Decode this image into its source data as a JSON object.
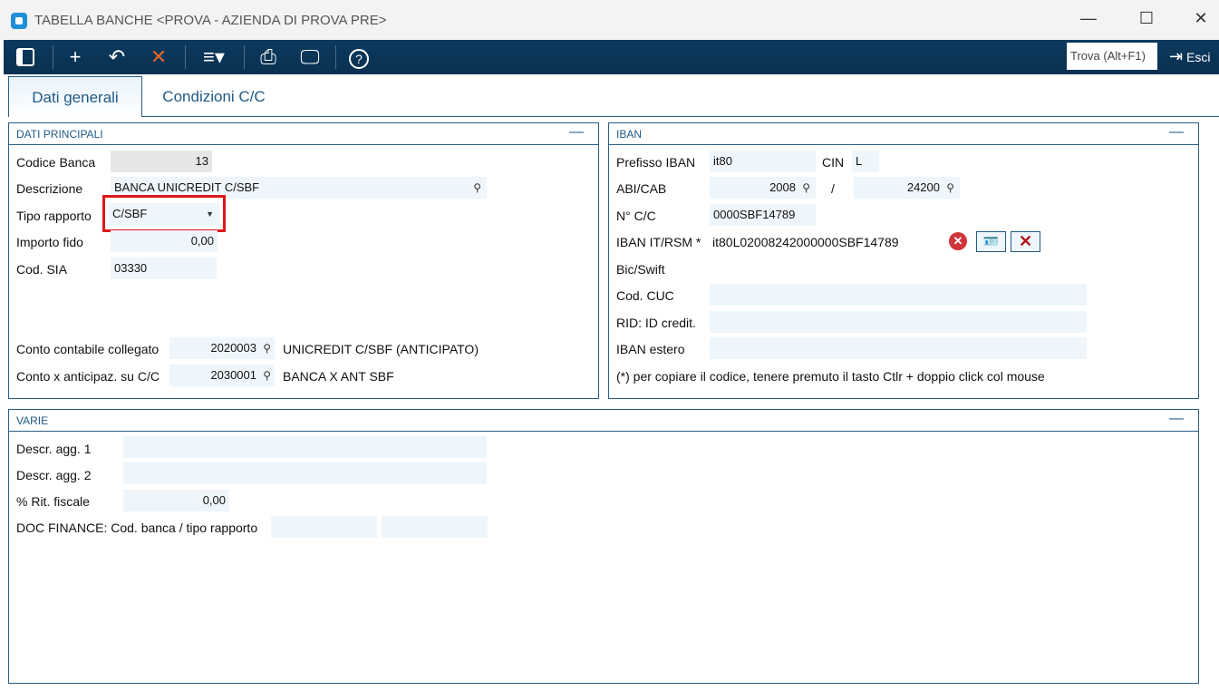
{
  "window": {
    "title": "TABELLA BANCHE <PROVA - AZIENDA DI PROVA PRE>",
    "minimize": "—",
    "maximize": "☐",
    "close": "✕"
  },
  "toolbar": {
    "find": "Trova (Alt+F1)",
    "exit": "Esci"
  },
  "tabs": [
    {
      "label": "Dati generali"
    },
    {
      "label": "Condizioni C/C"
    }
  ],
  "dati_principali": {
    "title": "DATI PRINCIPALI",
    "codice_banca_label": "Codice Banca",
    "codice_banca": "13",
    "descrizione_label": "Descrizione",
    "descrizione": "BANCA UNICREDIT C/SBF",
    "tipo_rapporto_label": "Tipo rapporto",
    "tipo_rapporto": "C/SBF",
    "importo_fido_label": "Importo fido",
    "importo_fido": "0,00",
    "cod_sia_label": "Cod. SIA",
    "cod_sia": "03330",
    "conto_collegato_label": "Conto contabile collegato",
    "conto_collegato": "2020003",
    "conto_collegato_desc": "UNICREDIT C/SBF (ANTICIPATO)",
    "conto_anticipaz_label": "Conto x anticipaz. su C/C",
    "conto_anticipaz": "2030001",
    "conto_anticipaz_desc": "BANCA X ANT SBF"
  },
  "iban": {
    "title": "IBAN",
    "prefisso_label": "Prefisso IBAN",
    "prefisso": "it80",
    "cin_label": "CIN",
    "cin": "L",
    "abicab_label": "ABI/CAB",
    "abi": "2008",
    "slash": "/",
    "cab": "24200",
    "nconto_label": "N° C/C",
    "nconto": "0000SBF14789",
    "iban_label": "IBAN IT/RSM *",
    "iban": "it80L02008242000000SBF14789",
    "bic_label": "Bic/Swift",
    "cuc_label": "Cod. CUC",
    "rid_label": "RID: ID credit.",
    "estero_label": "IBAN estero",
    "note": "(*) per copiare il codice, tenere premuto il tasto Ctlr + doppio click col mouse"
  },
  "varie": {
    "title": "VARIE",
    "descr1_label": "Descr. agg. 1",
    "descr2_label": "Descr. agg. 2",
    "rit_label": "% Rit. fiscale",
    "rit": "0,00",
    "doc_label": "DOC FINANCE: Cod. banca / tipo rapporto"
  }
}
